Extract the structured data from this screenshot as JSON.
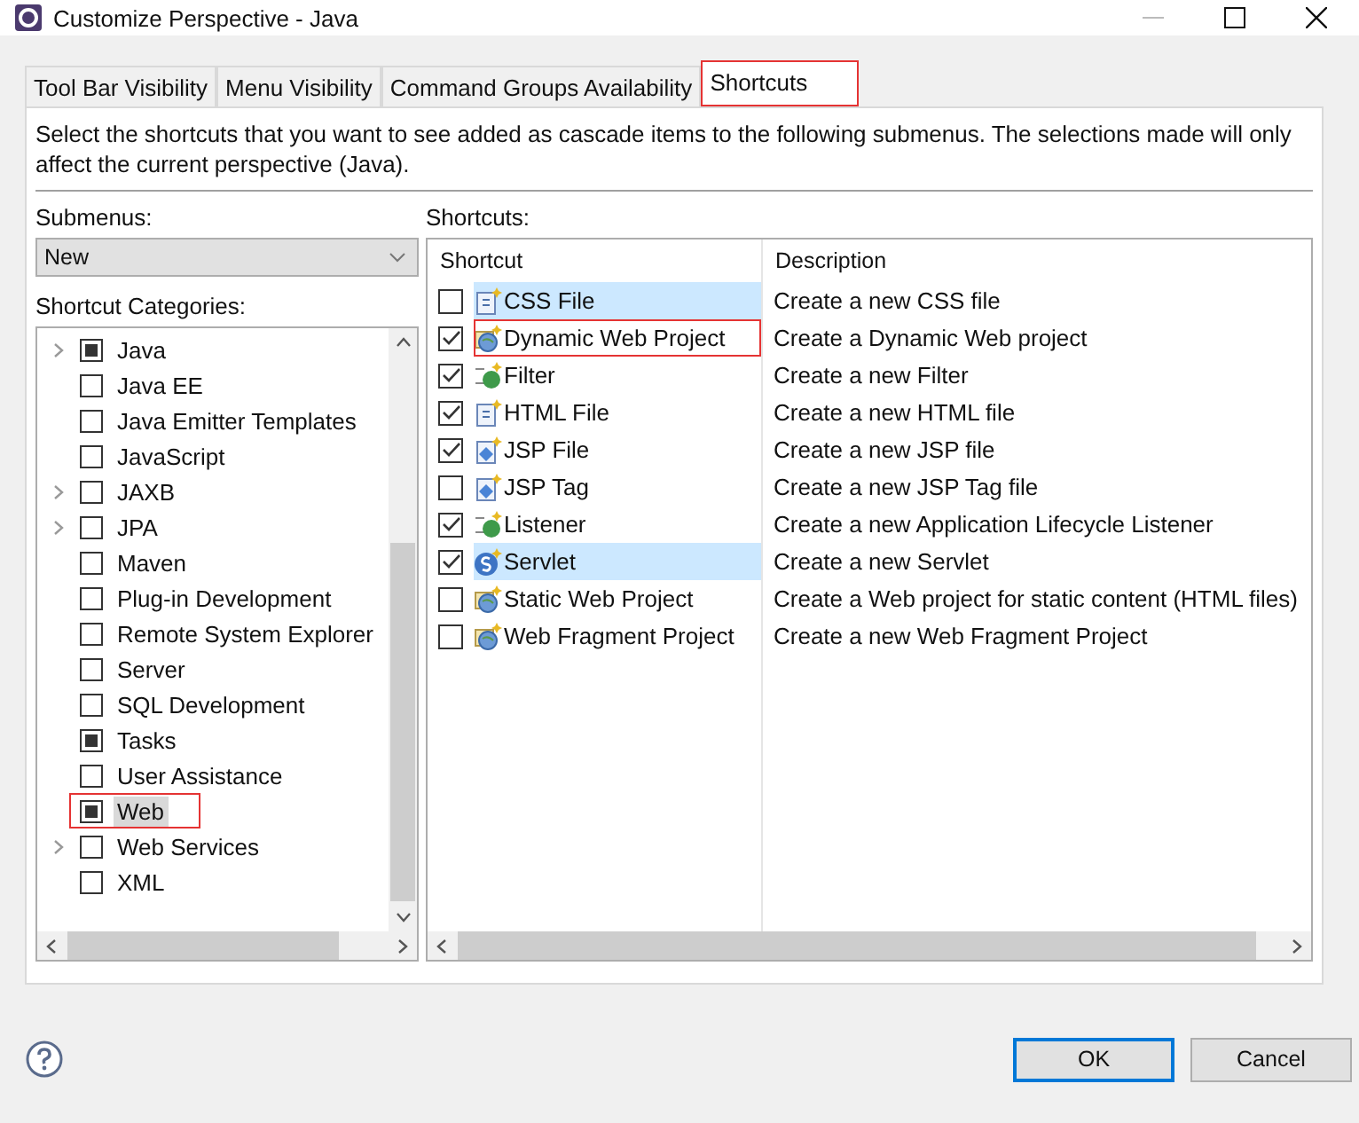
{
  "window": {
    "title": "Customize Perspective - Java"
  },
  "tabs": [
    {
      "label": "Tool Bar Visibility",
      "selected": false,
      "marked": false
    },
    {
      "label": "Menu Visibility",
      "selected": false,
      "marked": false
    },
    {
      "label": "Command Groups Availability",
      "selected": false,
      "marked": false
    },
    {
      "label": "Shortcuts",
      "selected": true,
      "marked": true
    }
  ],
  "description": "Select the shortcuts that you want to see added as cascade items to the following submenus.  The selections made will only affect the current perspective (Java).",
  "submenus": {
    "label": "Submenus:",
    "value": "New"
  },
  "categories_label": "Shortcut Categories:",
  "categories": [
    {
      "label": "Java",
      "checked": true,
      "expandable": true,
      "selected": false,
      "marked": false
    },
    {
      "label": "Java EE",
      "checked": false,
      "expandable": false,
      "selected": false,
      "marked": false
    },
    {
      "label": "Java Emitter Templates",
      "checked": false,
      "expandable": false,
      "selected": false,
      "marked": false
    },
    {
      "label": "JavaScript",
      "checked": false,
      "expandable": false,
      "selected": false,
      "marked": false
    },
    {
      "label": "JAXB",
      "checked": false,
      "expandable": true,
      "selected": false,
      "marked": false
    },
    {
      "label": "JPA",
      "checked": false,
      "expandable": true,
      "selected": false,
      "marked": false
    },
    {
      "label": "Maven",
      "checked": false,
      "expandable": false,
      "selected": false,
      "marked": false
    },
    {
      "label": "Plug-in Development",
      "checked": false,
      "expandable": false,
      "selected": false,
      "marked": false
    },
    {
      "label": "Remote System Explorer",
      "checked": false,
      "expandable": false,
      "selected": false,
      "marked": false
    },
    {
      "label": "Server",
      "checked": false,
      "expandable": false,
      "selected": false,
      "marked": false
    },
    {
      "label": "SQL Development",
      "checked": false,
      "expandable": false,
      "selected": false,
      "marked": false
    },
    {
      "label": "Tasks",
      "checked": true,
      "expandable": false,
      "selected": false,
      "marked": false
    },
    {
      "label": "User Assistance",
      "checked": false,
      "expandable": false,
      "selected": false,
      "marked": false
    },
    {
      "label": "Web",
      "checked": true,
      "expandable": false,
      "selected": true,
      "marked": true
    },
    {
      "label": "Web Services",
      "checked": false,
      "expandable": true,
      "selected": false,
      "marked": false
    },
    {
      "label": "XML",
      "checked": false,
      "expandable": false,
      "selected": false,
      "marked": false
    }
  ],
  "shortcuts_label": "Shortcuts:",
  "table": {
    "columns": [
      "Shortcut",
      "Description"
    ],
    "rows": [
      {
        "name": "CSS File",
        "description": "Create a new CSS file",
        "kind": "file",
        "checked": false,
        "selected": true,
        "marked": false
      },
      {
        "name": "Dynamic Web Project",
        "description": "Create a Dynamic Web project",
        "kind": "project",
        "checked": true,
        "selected": false,
        "marked": true
      },
      {
        "name": "Filter",
        "description": "Create a new Filter",
        "kind": "filter",
        "checked": true,
        "selected": false,
        "marked": false
      },
      {
        "name": "HTML File",
        "description": "Create a new HTML file",
        "kind": "file",
        "checked": true,
        "selected": false,
        "marked": false
      },
      {
        "name": "JSP File",
        "description": "Create a new JSP file",
        "kind": "jsp",
        "checked": true,
        "selected": false,
        "marked": false
      },
      {
        "name": "JSP Tag",
        "description": "Create a new JSP Tag file",
        "kind": "jsp",
        "checked": false,
        "selected": false,
        "marked": false
      },
      {
        "name": "Listener",
        "description": "Create a new Application Lifecycle Listener",
        "kind": "filter",
        "checked": true,
        "selected": false,
        "marked": false
      },
      {
        "name": "Servlet",
        "description": "Create a new Servlet",
        "kind": "servlet",
        "checked": true,
        "selected": true,
        "marked": false
      },
      {
        "name": "Static Web Project",
        "description": "Create a Web project for static content (HTML files)",
        "kind": "project",
        "checked": false,
        "selected": false,
        "marked": false
      },
      {
        "name": "Web Fragment Project",
        "description": "Create a new Web Fragment Project",
        "kind": "project",
        "checked": false,
        "selected": false,
        "marked": false
      }
    ]
  },
  "buttons": [
    {
      "label": "OK",
      "default": true
    },
    {
      "label": "Cancel",
      "default": false
    }
  ]
}
